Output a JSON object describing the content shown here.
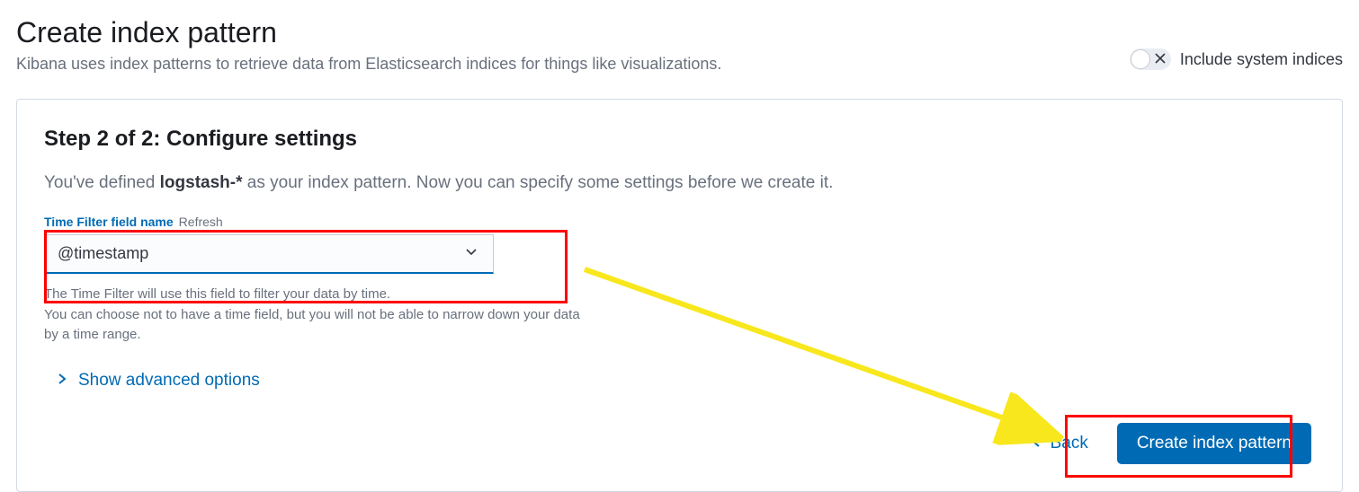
{
  "header": {
    "title": "Create index pattern",
    "subtitle": "Kibana uses index patterns to retrieve data from Elasticsearch indices for things like visualizations.",
    "toggle_label": "Include system indices"
  },
  "step": {
    "title": "Step 2 of 2: Configure settings",
    "desc_prefix": "You've defined ",
    "desc_pattern": "logstash-*",
    "desc_suffix": " as your index pattern. Now you can specify some settings before we create it."
  },
  "field": {
    "label": "Time Filter field name",
    "refresh": "Refresh",
    "value": "@timestamp",
    "help1": "The Time Filter will use this field to filter your data by time.",
    "help2": "You can choose not to have a time field, but you will not be able to narrow down your data by a time range."
  },
  "advanced": {
    "label": "Show advanced options"
  },
  "footer": {
    "back": "Back",
    "create": "Create index pattern"
  }
}
